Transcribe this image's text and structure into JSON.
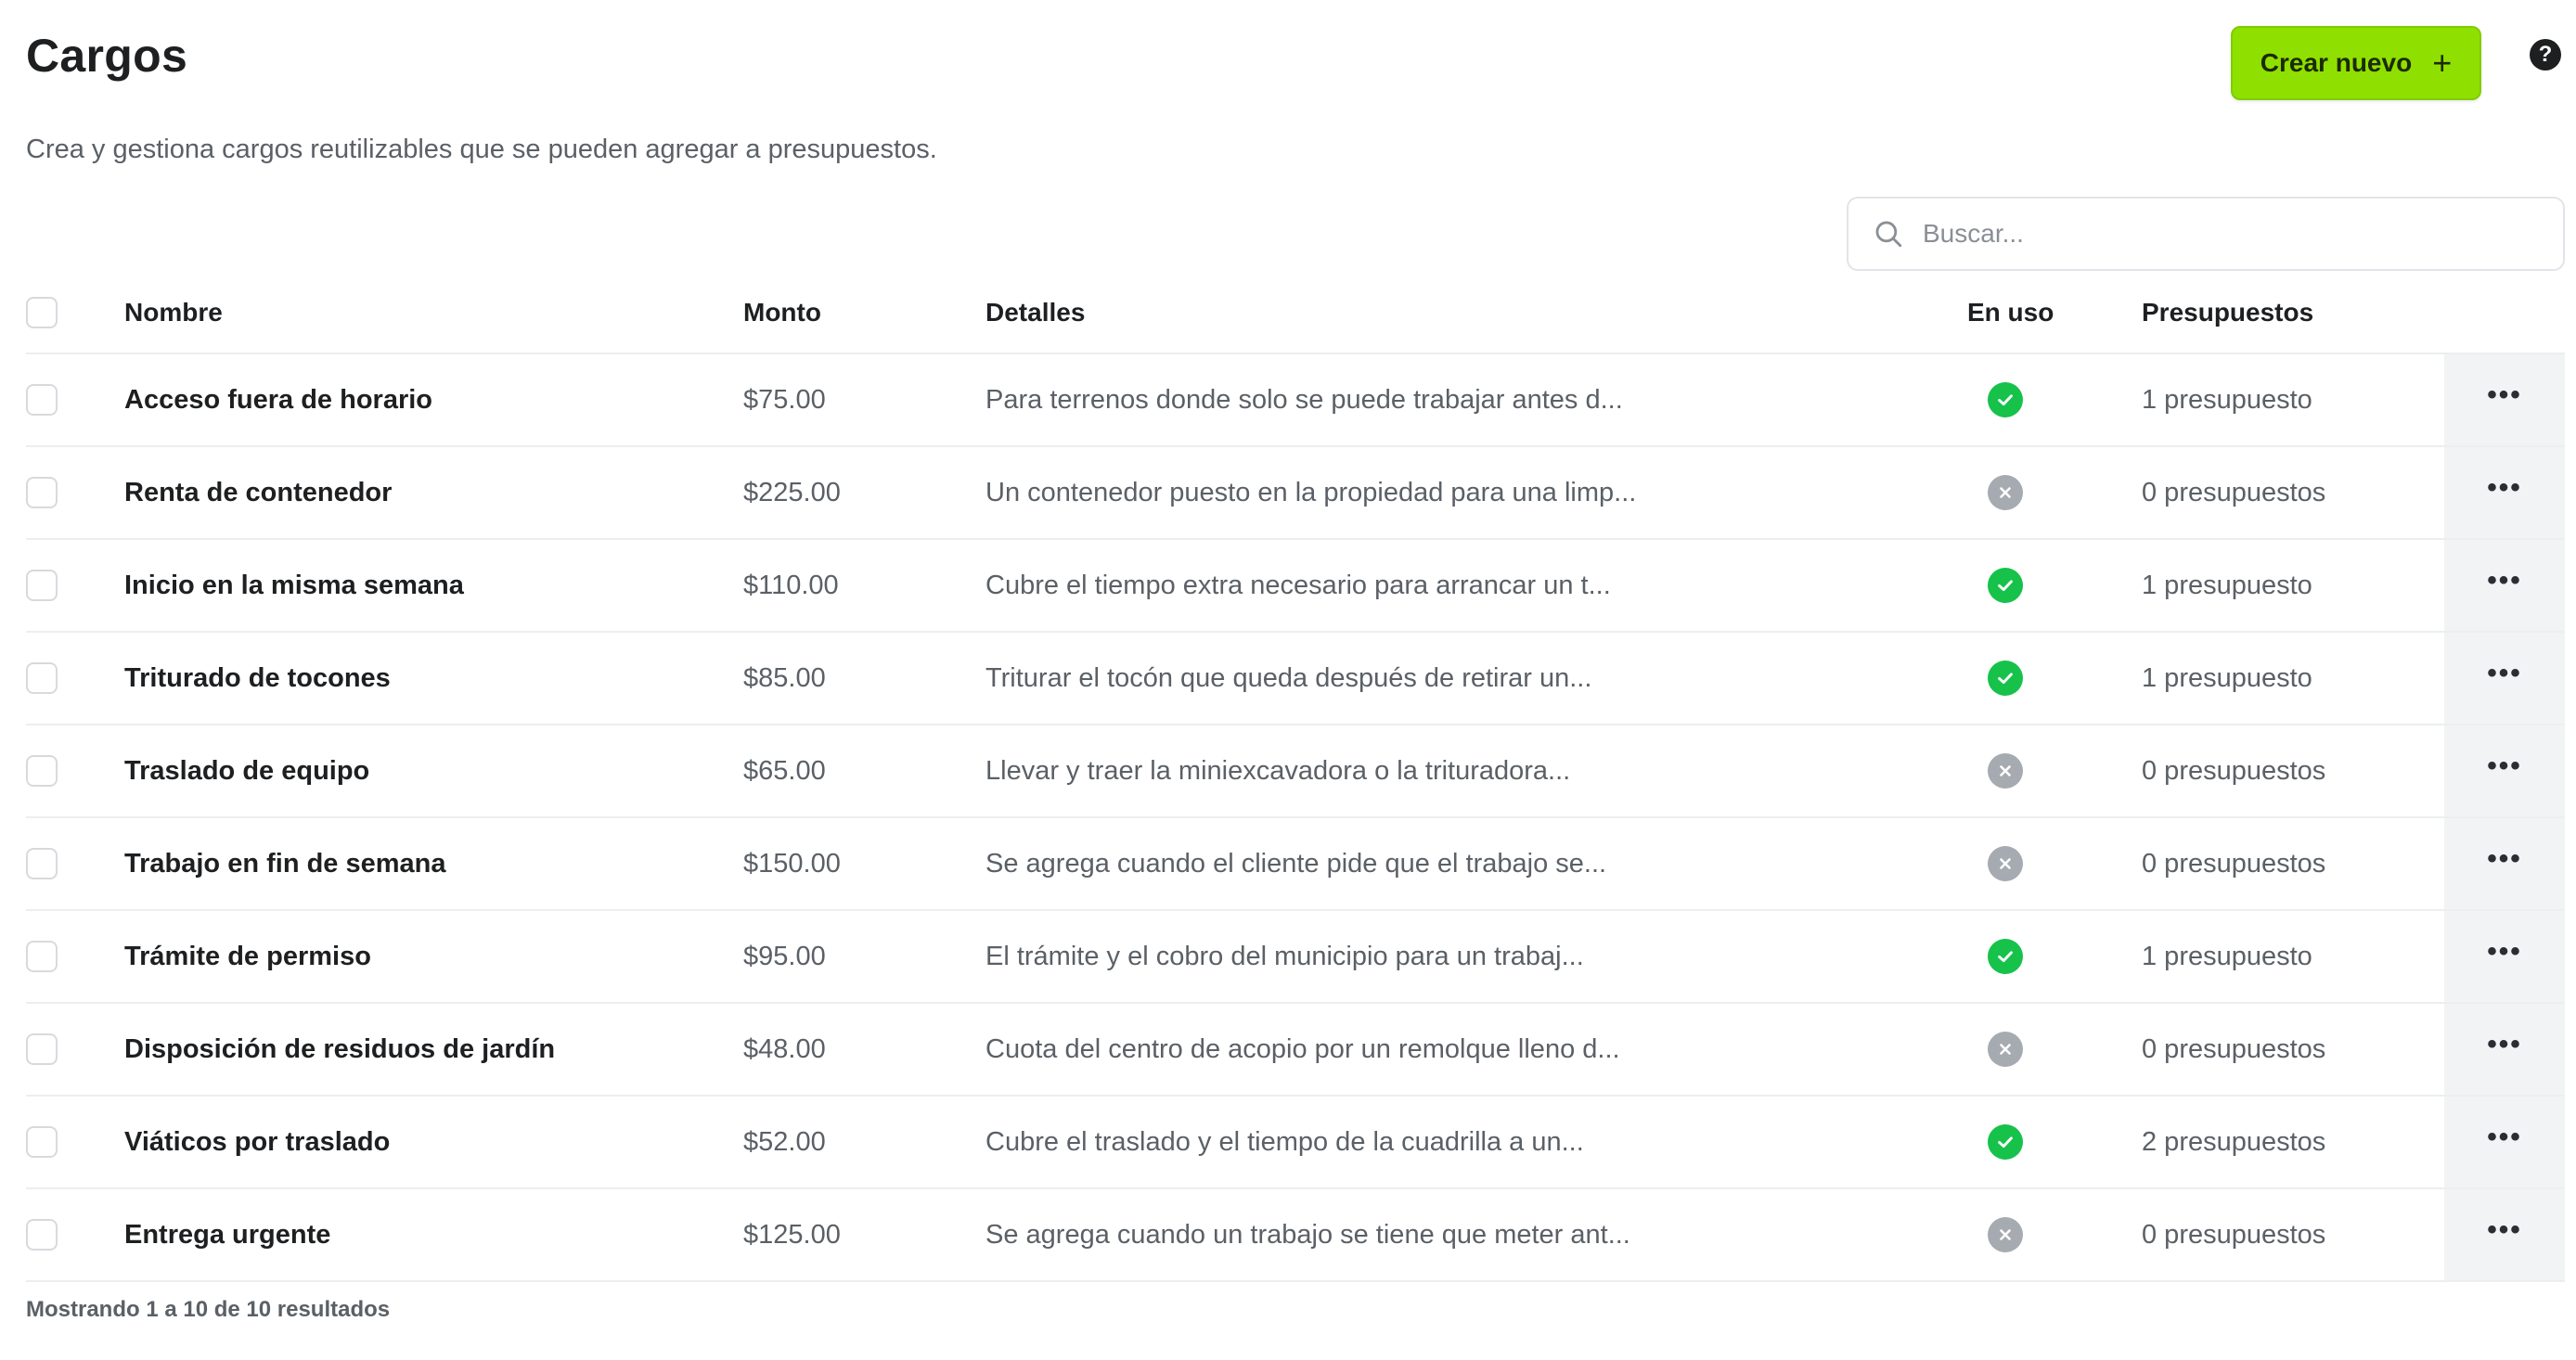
{
  "header": {
    "title": "Cargos",
    "subtitle": "Crea y gestiona cargos reutilizables que se pueden agregar a presupuestos.",
    "create_label": "Crear nuevo",
    "create_icon": "plus-icon",
    "help_icon": "question-circle-icon"
  },
  "search": {
    "placeholder": "Buscar...",
    "value": ""
  },
  "table": {
    "columns": {
      "name": "Nombre",
      "amount": "Monto",
      "details": "Detalles",
      "in_use": "En uso",
      "quotes": "Presupuestos"
    },
    "rows": [
      {
        "name": "Acceso fuera de horario",
        "amount": "$75.00",
        "details": "Para terrenos donde solo se puede trabajar antes d...",
        "in_use": true,
        "quotes": "1 presupuesto"
      },
      {
        "name": "Renta de contenedor",
        "amount": "$225.00",
        "details": "Un contenedor puesto en la propiedad para una limp...",
        "in_use": false,
        "quotes": "0 presupuestos"
      },
      {
        "name": "Inicio en la misma semana",
        "amount": "$110.00",
        "details": "Cubre el tiempo extra necesario para arrancar un t...",
        "in_use": true,
        "quotes": "1 presupuesto"
      },
      {
        "name": "Triturado de tocones",
        "amount": "$85.00",
        "details": "Triturar el tocón que queda después de retirar un...",
        "in_use": true,
        "quotes": "1 presupuesto"
      },
      {
        "name": "Traslado de equipo",
        "amount": "$65.00",
        "details": "Llevar y traer la miniexcavadora o la trituradora...",
        "in_use": false,
        "quotes": "0 presupuestos"
      },
      {
        "name": "Trabajo en fin de semana",
        "amount": "$150.00",
        "details": "Se agrega cuando el cliente pide que el trabajo se...",
        "in_use": false,
        "quotes": "0 presupuestos"
      },
      {
        "name": "Trámite de permiso",
        "amount": "$95.00",
        "details": "El trámite y el cobro del municipio para un trabaj...",
        "in_use": true,
        "quotes": "1 presupuesto"
      },
      {
        "name": "Disposición de residuos de jardín",
        "amount": "$48.00",
        "details": "Cuota del centro de acopio por un remolque lleno d...",
        "in_use": false,
        "quotes": "0 presupuestos"
      },
      {
        "name": "Viáticos por traslado",
        "amount": "$52.00",
        "details": "Cubre el traslado y el tiempo de la cuadrilla a un...",
        "in_use": true,
        "quotes": "2 presupuestos"
      },
      {
        "name": "Entrega urgente",
        "amount": "$125.00",
        "details": "Se agrega cuando un trabajo se tiene que meter ant...",
        "in_use": false,
        "quotes": "0 presupuestos"
      }
    ],
    "actions_icon": "more-horizontal-icon",
    "in_use_icons": {
      "yes": "check-circle-icon",
      "no": "x-circle-icon"
    }
  },
  "footer": {
    "results_text": "Mostrando 1 a 10 de 10 resultados"
  },
  "colors": {
    "accent": "#8fe000",
    "in_use_yes": "#16c24a",
    "in_use_no": "#a6abb1"
  }
}
